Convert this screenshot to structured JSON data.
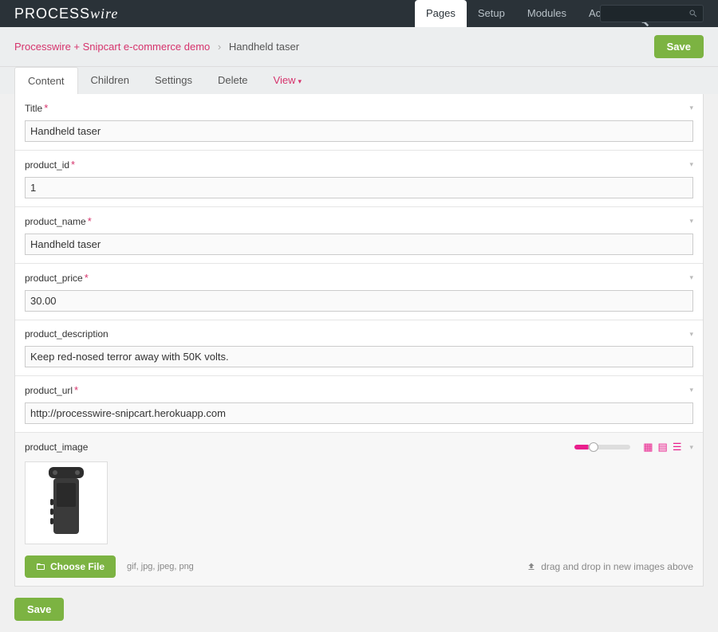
{
  "brand": {
    "first": "PROCESS",
    "second": "wire"
  },
  "topnav": {
    "pages": "Pages",
    "setup": "Setup",
    "modules": "Modules",
    "access": "Access"
  },
  "breadcrumb": {
    "a": "Processwire + Snipcart e-commerce demo",
    "current": "Handheld taser"
  },
  "buttons": {
    "save": "Save",
    "choose": "Choose File"
  },
  "tabs": {
    "content": "Content",
    "children": "Children",
    "settings": "Settings",
    "delete": "Delete",
    "view": "View"
  },
  "fields": {
    "title": {
      "label": "Title",
      "value": "Handheld taser",
      "required": true
    },
    "product_id": {
      "label": "product_id",
      "value": "1",
      "required": true
    },
    "product_name": {
      "label": "product_name",
      "value": "Handheld taser",
      "required": true
    },
    "product_price": {
      "label": "product_price",
      "value": "30.00",
      "required": true
    },
    "product_description": {
      "label": "product_description",
      "value": "Keep red-nosed terror away with 50K volts.",
      "required": false
    },
    "product_url": {
      "label": "product_url",
      "value": "http://processwire-snipcart.herokuapp.com",
      "required": true
    },
    "product_image": {
      "label": "product_image"
    }
  },
  "upload": {
    "allowed": "gif, jpg, jpeg, png",
    "dropzone": "drag and drop in new images above"
  }
}
